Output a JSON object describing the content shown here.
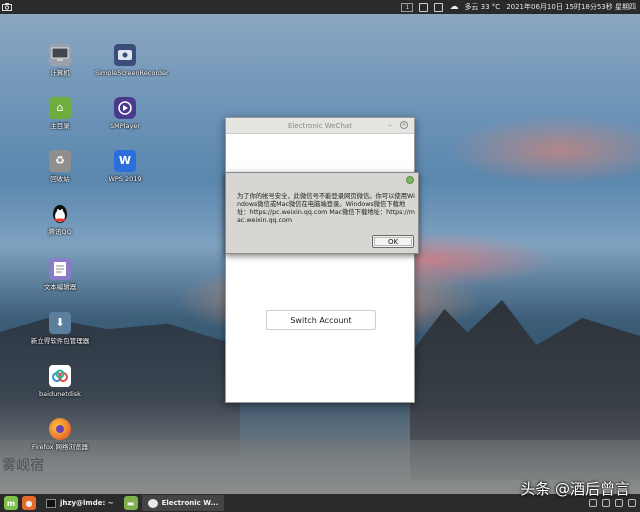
{
  "top_panel": {
    "weather": "多云 33 °C",
    "datetime": "2021年06月10日 15时18分53秒 星期四",
    "workspace": "1"
  },
  "desktop_icons": [
    {
      "label": "计算机",
      "icon": "computer-icon",
      "color": "#9aa3ad"
    },
    {
      "label": "主目录",
      "icon": "home-folder-icon",
      "color": "#6fae3d"
    },
    {
      "label": "回收站",
      "icon": "trash-icon",
      "color": "#8f8f8f"
    },
    {
      "label": "腾讯QQ",
      "icon": "qq-penguin-icon",
      "color": "#1a1a1a"
    },
    {
      "label": "文本编辑器",
      "icon": "text-editor-icon",
      "color": "#8a7cc6"
    },
    {
      "label": "新立得软件包管理器",
      "icon": "package-manager-icon",
      "color": "#5d7f9e"
    },
    {
      "label": "baidunetdisk",
      "icon": "baidu-cloud-icon",
      "color": "#3a8ee6"
    },
    {
      "label": "Firefox 网络浏览器",
      "icon": "firefox-icon",
      "color": "#e66a2c"
    },
    {
      "label": "SimpleScreenRecorder",
      "icon": "screen-recorder-icon",
      "color": "#3b4e7a"
    },
    {
      "label": "SMPlayer",
      "icon": "smplayer-icon",
      "color": "#4b3a8c"
    },
    {
      "label": "WPS 2019",
      "icon": "wps-icon",
      "color": "#2a6fdb"
    }
  ],
  "wechat_window": {
    "title": "Electronic WeChat",
    "switch_account_label": "Switch Account"
  },
  "alert": {
    "message": "为了你的帐号安全，此微信号不能登录网页微信。你可以使用Windows微信或Mac微信在电脑端登录。Windows微信下载地址：https://pc.weixin.qq.com Mac微信下载地址：https://mac.weixin.qq.com",
    "ok_label": "OK"
  },
  "taskbar": {
    "terminal_label": "jhzy@lmde: ~",
    "wechat_label": "Electronic W..."
  },
  "watermark": "头条 @酒后曾言",
  "signature": "雾岘宿"
}
